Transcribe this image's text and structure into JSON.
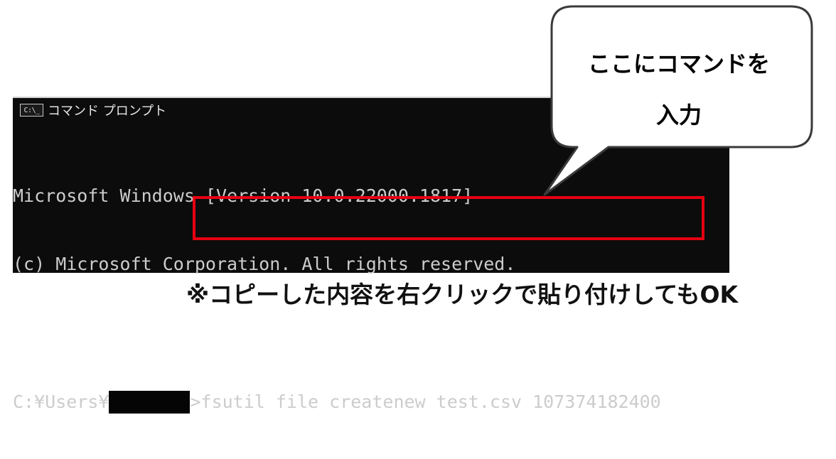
{
  "terminal": {
    "icon_label": "C:\\_",
    "title": "コマンド プロンプト",
    "lines": [
      "Microsoft Windows [Version 10.0.22000.1817]",
      "(c) Microsoft Corporation. All rights reserved."
    ],
    "prompt_prefix": "C:¥Users¥",
    "command": ">fsutil file createnew test.csv 107374182400"
  },
  "callout": {
    "line1": "ここにコマンドを",
    "line2": "入力"
  },
  "footnote": "※コピーした内容を右クリックで貼り付けしてもOK",
  "colors": {
    "terminal_background": "#0c0c0c",
    "terminal_text": "#cccccc",
    "highlight_box": "#e60012"
  }
}
